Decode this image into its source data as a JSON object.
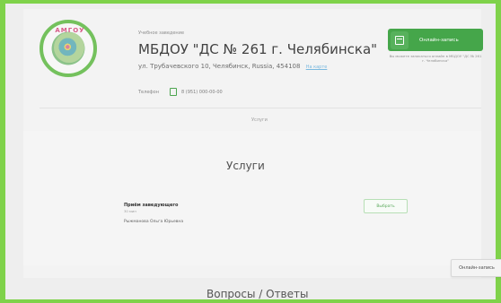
{
  "organization": {
    "kind": "Учебное заведение",
    "title": "МБДОУ \"ДС № 261 г. Челябинска\"",
    "address": "ул. Трубачевского 10, Челябинск, Russia, 454108",
    "map_link": "На карте",
    "phone_label": "Телефон",
    "phone_number": "8 (951) 000-00-00"
  },
  "online_booking": {
    "button_label": "Онлайн-запись",
    "note": "Вы можете записаться онлайн в МБДОУ \"ДС № 261 г. Челябинска\""
  },
  "tabs": {
    "services": "Услуги"
  },
  "services": {
    "title": "Услуги",
    "item": {
      "name": "Приём заведующего",
      "duration": "30 мин",
      "person": "Рыжманова Ольга Юрьевна",
      "choose_label": "Выбрать"
    }
  },
  "floating_button": {
    "label": "Онлайн-запись"
  },
  "faq": {
    "title": "Вопросы / Ответы"
  },
  "colors": {
    "accent": "#45a64a",
    "frame": "#7fd24a"
  },
  "icons": [
    "logo-icon",
    "calendar-icon",
    "phone-icon"
  ]
}
